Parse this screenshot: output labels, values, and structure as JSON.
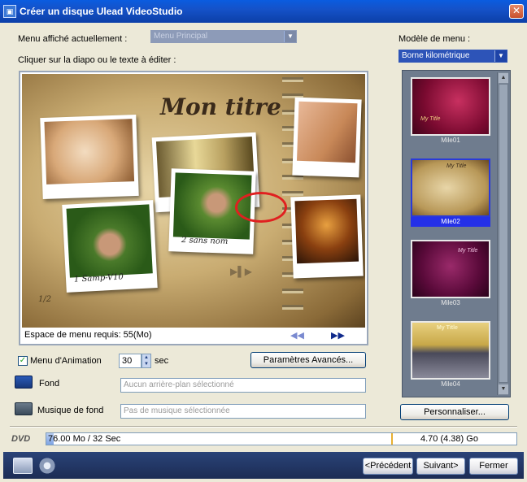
{
  "window": {
    "title": "Créer un disque Ulead VideoStudio",
    "close_label": "✕"
  },
  "menu_display": {
    "label": "Menu affiché actuellement :",
    "selected": "Menu Principal"
  },
  "edit_hint": "Cliquer sur la diapo ou le texte à éditer :",
  "preview": {
    "title_text": "Mon titre",
    "caption1": "1 Samp-V10",
    "caption2": "2 sans nom",
    "page_number": "1/2",
    "menu_space": "Espace de menu requis: 55(Mo)",
    "prev_symbol": "◀◀",
    "next_symbol": "▶▶"
  },
  "template": {
    "label": "Modèle de menu :",
    "selected": "Borne kilométrique",
    "thumbnails": [
      {
        "name": "Mile01",
        "title": "My Title"
      },
      {
        "name": "Mile02",
        "title": "My Title"
      },
      {
        "name": "Mile03",
        "title": "My Title"
      },
      {
        "name": "Mile04",
        "title": "My Title"
      }
    ],
    "selected_index": 1
  },
  "animation": {
    "checkbox_label": "Menu d'Animation",
    "checked": true,
    "seconds_value": "30",
    "seconds_unit": "sec",
    "advanced_button": "Paramètres Avancés..."
  },
  "background": {
    "label": "Fond",
    "placeholder": "Aucun arrière-plan sélectionné"
  },
  "music": {
    "label": "Musique de fond",
    "placeholder": "Pas de musique sélectionnée"
  },
  "customize_button": "Personnaliser...",
  "disc": {
    "type_label": "DVD",
    "used": "76.00 Mo / 32 Sec",
    "capacity": "4.70 (4.38) Go",
    "used_fraction": 0.016
  },
  "nav": {
    "prev": "<Précédent",
    "next": "Suivant>",
    "close": "Fermer"
  },
  "colors": {
    "titlebar": "#1552c8",
    "selection": "#2430e8",
    "thumb_panel": "#6f7c8e",
    "bottom_bar": "#1c2c54"
  }
}
